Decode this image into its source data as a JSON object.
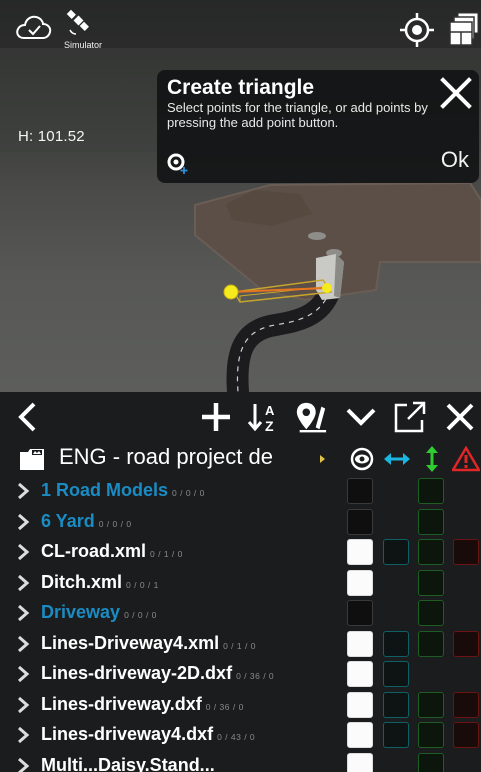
{
  "top_bar": {
    "cloud_icon": "cloud-check-icon",
    "satellite_icon": "satellite-icon",
    "simulator_label": "Simulator",
    "locate_icon": "locate-target-icon",
    "layers_icon": "layers-icon"
  },
  "viewport": {
    "height_label": "H: 101.52"
  },
  "dialog": {
    "title": "Create triangle",
    "message_line1": "Select points for the triangle, or add points by",
    "message_line2": "pressing the add point button.",
    "ok_label": "Ok",
    "add_point_icon": "add-point-icon",
    "close_icon": "close-icon"
  },
  "toolbar": {
    "icons": [
      "back-chevron-icon",
      "add-icon",
      "sort-az-icon",
      "edit-map-marker-icon",
      "collapse-chevron-icon",
      "open-external-icon",
      "close-icon"
    ]
  },
  "header": {
    "title": "ENG - road project de",
    "columns": [
      "eye-icon",
      "horizontal-arrows-icon",
      "vertical-arrows-icon",
      "warning-icon"
    ],
    "colors": {
      "cyan": "#1ab6e0",
      "green": "#2ecc2e",
      "red": "#e02626"
    }
  },
  "rows": [
    {
      "name": "1 Road Models",
      "counts": "0 / 0 / 0",
      "folder": true,
      "cells": [
        "off",
        "",
        "green",
        ""
      ]
    },
    {
      "name": "6 Yard",
      "counts": "0 / 0 / 0",
      "folder": true,
      "cells": [
        "off",
        "",
        "green",
        ""
      ]
    },
    {
      "name": "CL-road.xml",
      "counts": "0 / 1 / 0",
      "folder": false,
      "cells": [
        "on",
        "cyan",
        "green",
        "red"
      ]
    },
    {
      "name": "Ditch.xml",
      "counts": "0 / 0 / 1",
      "folder": false,
      "cells": [
        "on",
        "",
        "green",
        ""
      ]
    },
    {
      "name": "Driveway",
      "counts": "0 / 0 / 0",
      "folder": true,
      "cells": [
        "off",
        "",
        "green",
        ""
      ]
    },
    {
      "name": "Lines-Driveway4.xml",
      "counts": "0 / 1 / 0",
      "folder": false,
      "cells": [
        "on",
        "cyan",
        "green",
        "red"
      ]
    },
    {
      "name": "Lines-driveway-2D.dxf",
      "counts": "0 / 36 / 0",
      "folder": false,
      "cells": [
        "on",
        "cyan",
        "",
        ""
      ]
    },
    {
      "name": "Lines-driveway.dxf",
      "counts": "0 / 36 / 0",
      "folder": false,
      "cells": [
        "on",
        "cyan",
        "green",
        "red"
      ]
    },
    {
      "name": "Lines-driveway4.dxf",
      "counts": "0 / 43 / 0",
      "folder": false,
      "cells": [
        "on",
        "cyan",
        "green",
        "red"
      ]
    },
    {
      "name": "Multi...Daisy.Stand...",
      "counts": "",
      "folder": false,
      "cells": [
        "on",
        "",
        "green",
        ""
      ]
    }
  ]
}
